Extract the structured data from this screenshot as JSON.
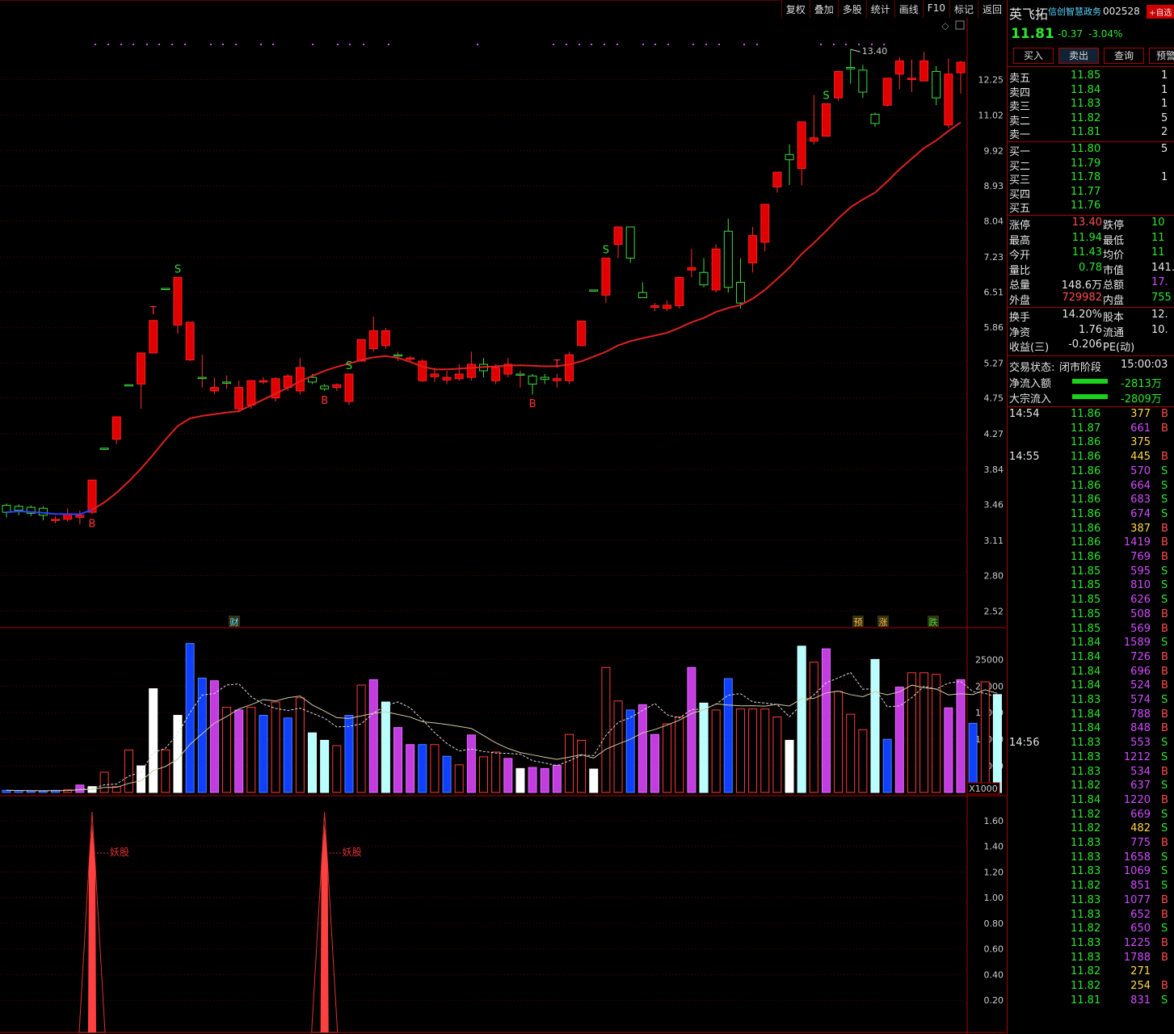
{
  "toolbar": {
    "items": [
      "复权",
      "叠加",
      "多股",
      "统计",
      "画线",
      "F10",
      "标记",
      "返回"
    ]
  },
  "stock": {
    "name": "英飞拓",
    "sector": "信创智慧政务",
    "code": "002528",
    "fav": "+自选",
    "price": "11.81",
    "change": "-0.37",
    "pct": "-3.04%"
  },
  "actions": {
    "buy": "买入",
    "sell": "卖出",
    "query": "查询",
    "warn": "预警"
  },
  "orderbook": {
    "asks": [
      {
        "label": "卖五",
        "price": "11.85",
        "vol": "1"
      },
      {
        "label": "卖四",
        "price": "11.84",
        "vol": "1"
      },
      {
        "label": "卖三",
        "price": "11.83",
        "vol": "1"
      },
      {
        "label": "卖二",
        "price": "11.82",
        "vol": "5"
      },
      {
        "label": "卖一",
        "price": "11.81",
        "vol": "2"
      }
    ],
    "bids": [
      {
        "label": "买一",
        "price": "11.80",
        "vol": "5"
      },
      {
        "label": "买二",
        "price": "11.79",
        "vol": ""
      },
      {
        "label": "买三",
        "price": "11.78",
        "vol": "1"
      },
      {
        "label": "买四",
        "price": "11.77",
        "vol": ""
      },
      {
        "label": "买五",
        "price": "11.76",
        "vol": ""
      }
    ]
  },
  "stats": [
    {
      "l1": "涨停",
      "v1": "13.40",
      "c1": "red",
      "l2": "跌停",
      "v2": "10",
      "c2": "green"
    },
    {
      "l1": "最高",
      "v1": "11.94",
      "c1": "green",
      "l2": "最低",
      "v2": "11",
      "c2": "green"
    },
    {
      "l1": "今开",
      "v1": "11.43",
      "c1": "green",
      "l2": "均价",
      "v2": "11",
      "c2": "green"
    },
    {
      "l1": "量比",
      "v1": "0.78",
      "c1": "green",
      "l2": "市值",
      "v2": "141.",
      "c2": "white"
    },
    {
      "l1": "总量",
      "v1": "148.6万",
      "c1": "white",
      "l2": "总额",
      "v2": "17.",
      "c2": "mag"
    },
    {
      "l1": "外盘",
      "v1": "729982",
      "c1": "red",
      "l2": "内盘",
      "v2": "755",
      "c2": "green"
    }
  ],
  "stats2": [
    {
      "l1": "换手",
      "v1": "14.20%",
      "l2": "股本",
      "v2": "12."
    },
    {
      "l1": "净资",
      "v1": "1.76",
      "l2": "流通",
      "v2": "10."
    },
    {
      "l1": "收益(三)",
      "v1": "-0.206",
      "l2": "PE(动)",
      "v2": ""
    }
  ],
  "trade_status": {
    "label": "交易状态:",
    "value": "闭市阶段",
    "time": "15:00:03"
  },
  "flows": [
    {
      "label": "净流入额",
      "value": "-2813万"
    },
    {
      "label": "大宗流入",
      "value": "-2809万"
    }
  ],
  "ticks": [
    {
      "t": "14:54",
      "p": "11.86",
      "v": "377",
      "s": "B"
    },
    {
      "t": "",
      "p": "11.87",
      "v": "661",
      "s": "B"
    },
    {
      "t": "",
      "p": "11.86",
      "v": "375",
      "s": ""
    },
    {
      "t": "14:55",
      "p": "11.86",
      "v": "445",
      "s": "B"
    },
    {
      "t": "",
      "p": "11.86",
      "v": "570",
      "s": "S"
    },
    {
      "t": "",
      "p": "11.86",
      "v": "664",
      "s": "S"
    },
    {
      "t": "",
      "p": "11.86",
      "v": "683",
      "s": "S"
    },
    {
      "t": "",
      "p": "11.86",
      "v": "674",
      "s": "S"
    },
    {
      "t": "",
      "p": "11.86",
      "v": "387",
      "s": "B"
    },
    {
      "t": "",
      "p": "11.86",
      "v": "1419",
      "s": "B"
    },
    {
      "t": "",
      "p": "11.86",
      "v": "769",
      "s": "B"
    },
    {
      "t": "",
      "p": "11.85",
      "v": "595",
      "s": "S"
    },
    {
      "t": "",
      "p": "11.85",
      "v": "810",
      "s": "S"
    },
    {
      "t": "",
      "p": "11.85",
      "v": "626",
      "s": "S"
    },
    {
      "t": "",
      "p": "11.85",
      "v": "508",
      "s": "B"
    },
    {
      "t": "",
      "p": "11.85",
      "v": "569",
      "s": "B"
    },
    {
      "t": "",
      "p": "11.84",
      "v": "1589",
      "s": "S"
    },
    {
      "t": "",
      "p": "11.84",
      "v": "726",
      "s": "B"
    },
    {
      "t": "",
      "p": "11.84",
      "v": "696",
      "s": "B"
    },
    {
      "t": "",
      "p": "11.84",
      "v": "524",
      "s": "B"
    },
    {
      "t": "",
      "p": "11.83",
      "v": "574",
      "s": "S"
    },
    {
      "t": "",
      "p": "11.84",
      "v": "788",
      "s": "B"
    },
    {
      "t": "",
      "p": "11.84",
      "v": "848",
      "s": "B"
    },
    {
      "t": "14:56",
      "p": "11.83",
      "v": "553",
      "s": "S"
    },
    {
      "t": "",
      "p": "11.83",
      "v": "1212",
      "s": "S"
    },
    {
      "t": "",
      "p": "11.83",
      "v": "534",
      "s": "B"
    },
    {
      "t": "",
      "p": "11.82",
      "v": "637",
      "s": "S"
    },
    {
      "t": "",
      "p": "11.84",
      "v": "1220",
      "s": "B"
    },
    {
      "t": "",
      "p": "11.82",
      "v": "669",
      "s": "S"
    },
    {
      "t": "",
      "p": "11.82",
      "v": "482",
      "s": "S"
    },
    {
      "t": "",
      "p": "11.83",
      "v": "775",
      "s": "B"
    },
    {
      "t": "",
      "p": "11.83",
      "v": "1658",
      "s": "S"
    },
    {
      "t": "",
      "p": "11.83",
      "v": "1069",
      "s": "S"
    },
    {
      "t": "",
      "p": "11.82",
      "v": "851",
      "s": "S"
    },
    {
      "t": "",
      "p": "11.83",
      "v": "1077",
      "s": "B"
    },
    {
      "t": "",
      "p": "11.83",
      "v": "652",
      "s": "B"
    },
    {
      "t": "",
      "p": "11.82",
      "v": "650",
      "s": "S"
    },
    {
      "t": "",
      "p": "11.83",
      "v": "1225",
      "s": "B"
    },
    {
      "t": "",
      "p": "11.83",
      "v": "1788",
      "s": "B"
    },
    {
      "t": "",
      "p": "11.82",
      "v": "271",
      "s": ""
    },
    {
      "t": "",
      "p": "11.82",
      "v": "254",
      "s": "B"
    },
    {
      "t": "",
      "p": "11.81",
      "v": "831",
      "s": "S"
    }
  ],
  "chart_data": {
    "type": "candlestick",
    "price_axis_ticks": [
      "12.25",
      "11.02",
      "9.92",
      "8.93",
      "8.04",
      "7.23",
      "6.51",
      "5.86",
      "5.27",
      "4.75",
      "4.27",
      "3.84",
      "3.46",
      "3.11",
      "2.80",
      "2.52"
    ],
    "price_axis_scale": "log",
    "max_marker": "13.40",
    "volume_axis_ticks": [
      "25000",
      "20000",
      "15000",
      "10000",
      "5000"
    ],
    "volume_unit": "X1000",
    "indicator_axis_ticks": [
      "1.60",
      "1.40",
      "1.20",
      "1.00",
      "0.80",
      "0.60",
      "0.40",
      "0.20"
    ],
    "event_markers": [
      "财",
      "预",
      "涨",
      "跌"
    ],
    "indicator_label": "妖股",
    "candles": [
      {
        "o": 3.45,
        "h": 3.47,
        "l": 3.33,
        "c": 3.38
      },
      {
        "o": 3.44,
        "h": 3.46,
        "l": 3.35,
        "c": 3.4
      },
      {
        "o": 3.43,
        "h": 3.45,
        "l": 3.34,
        "c": 3.37
      },
      {
        "o": 3.42,
        "h": 3.44,
        "l": 3.3,
        "c": 3.35
      },
      {
        "o": 3.3,
        "h": 3.34,
        "l": 3.27,
        "c": 3.31
      },
      {
        "o": 3.31,
        "h": 3.42,
        "l": 3.29,
        "c": 3.36
      },
      {
        "o": 3.33,
        "h": 3.4,
        "l": 3.26,
        "c": 3.35
      },
      {
        "o": 3.38,
        "h": 3.72,
        "l": 3.36,
        "c": 3.72
      },
      {
        "o": 4.09,
        "h": 4.09,
        "l": 4.09,
        "c": 4.09
      },
      {
        "o": 4.2,
        "h": 4.49,
        "l": 4.14,
        "c": 4.49
      },
      {
        "o": 4.94,
        "h": 4.94,
        "l": 4.94,
        "c": 4.94
      },
      {
        "o": 4.95,
        "h": 5.43,
        "l": 4.6,
        "c": 5.43
      },
      {
        "o": 5.43,
        "h": 5.98,
        "l": 5.43,
        "c": 5.98
      },
      {
        "o": 6.58,
        "h": 6.58,
        "l": 6.58,
        "c": 6.58
      },
      {
        "o": 5.9,
        "h": 6.8,
        "l": 5.75,
        "c": 6.8
      },
      {
        "o": 5.32,
        "h": 5.95,
        "l": 5.3,
        "c": 5.95
      },
      {
        "o": 5.05,
        "h": 5.4,
        "l": 4.9,
        "c": 5.05
      },
      {
        "o": 4.85,
        "h": 5.05,
        "l": 4.8,
        "c": 4.9
      },
      {
        "o": 4.98,
        "h": 5.08,
        "l": 4.88,
        "c": 4.98
      },
      {
        "o": 4.6,
        "h": 5.0,
        "l": 4.55,
        "c": 4.9
      },
      {
        "o": 4.65,
        "h": 5.0,
        "l": 4.6,
        "c": 5.0
      },
      {
        "o": 4.98,
        "h": 5.05,
        "l": 4.95,
        "c": 5.0
      },
      {
        "o": 4.75,
        "h": 5.05,
        "l": 4.7,
        "c": 5.03
      },
      {
        "o": 4.9,
        "h": 5.1,
        "l": 4.85,
        "c": 5.07
      },
      {
        "o": 4.85,
        "h": 5.35,
        "l": 4.8,
        "c": 5.2
      },
      {
        "o": 5.05,
        "h": 5.1,
        "l": 4.95,
        "c": 4.98
      },
      {
        "o": 4.92,
        "h": 4.95,
        "l": 4.85,
        "c": 4.88
      },
      {
        "o": 4.9,
        "h": 4.96,
        "l": 4.85,
        "c": 4.94
      },
      {
        "o": 4.7,
        "h": 5.1,
        "l": 4.65,
        "c": 5.1
      },
      {
        "o": 5.3,
        "h": 5.65,
        "l": 5.3,
        "c": 5.65
      },
      {
        "o": 5.5,
        "h": 6.05,
        "l": 5.45,
        "c": 5.8
      },
      {
        "o": 5.55,
        "h": 5.85,
        "l": 5.5,
        "c": 5.8
      },
      {
        "o": 5.4,
        "h": 5.45,
        "l": 5.3,
        "c": 5.4
      },
      {
        "o": 5.33,
        "h": 5.38,
        "l": 5.28,
        "c": 5.35
      },
      {
        "o": 5.0,
        "h": 5.33,
        "l": 4.98,
        "c": 5.3
      },
      {
        "o": 5.06,
        "h": 5.2,
        "l": 4.98,
        "c": 5.1
      },
      {
        "o": 5.01,
        "h": 5.15,
        "l": 4.95,
        "c": 5.05
      },
      {
        "o": 5.03,
        "h": 5.25,
        "l": 5.0,
        "c": 5.1
      },
      {
        "o": 5.05,
        "h": 5.45,
        "l": 5.0,
        "c": 5.25
      },
      {
        "o": 5.25,
        "h": 5.35,
        "l": 5.05,
        "c": 5.15
      },
      {
        "o": 5.0,
        "h": 5.25,
        "l": 4.95,
        "c": 5.2
      },
      {
        "o": 5.1,
        "h": 5.35,
        "l": 5.05,
        "c": 5.25
      },
      {
        "o": 5.1,
        "h": 5.15,
        "l": 4.9,
        "c": 5.1
      },
      {
        "o": 5.07,
        "h": 5.1,
        "l": 4.8,
        "c": 4.95
      },
      {
        "o": 5.05,
        "h": 5.1,
        "l": 4.95,
        "c": 5.02
      },
      {
        "o": 5.0,
        "h": 5.1,
        "l": 4.9,
        "c": 5.03
      },
      {
        "o": 5.0,
        "h": 5.45,
        "l": 4.95,
        "c": 5.4
      },
      {
        "o": 5.55,
        "h": 5.97,
        "l": 5.55,
        "c": 5.97
      },
      {
        "o": 6.55,
        "h": 6.55,
        "l": 6.55,
        "c": 6.55
      },
      {
        "o": 6.45,
        "h": 7.2,
        "l": 6.3,
        "c": 7.2
      },
      {
        "o": 7.5,
        "h": 7.9,
        "l": 7.2,
        "c": 7.9
      },
      {
        "o": 7.9,
        "h": 7.9,
        "l": 7.1,
        "c": 7.2
      },
      {
        "o": 6.5,
        "h": 6.7,
        "l": 6.4,
        "c": 6.4
      },
      {
        "o": 6.22,
        "h": 6.3,
        "l": 6.15,
        "c": 6.25
      },
      {
        "o": 6.2,
        "h": 6.35,
        "l": 6.15,
        "c": 6.26
      },
      {
        "o": 6.25,
        "h": 6.8,
        "l": 6.2,
        "c": 6.8
      },
      {
        "o": 6.95,
        "h": 7.4,
        "l": 6.8,
        "c": 7.0
      },
      {
        "o": 6.9,
        "h": 7.2,
        "l": 6.6,
        "c": 6.65
      },
      {
        "o": 6.55,
        "h": 7.5,
        "l": 6.5,
        "c": 7.4
      },
      {
        "o": 7.8,
        "h": 8.1,
        "l": 6.5,
        "c": 6.6
      },
      {
        "o": 6.7,
        "h": 7.2,
        "l": 6.2,
        "c": 6.3
      },
      {
        "o": 7.1,
        "h": 7.9,
        "l": 6.9,
        "c": 7.7
      },
      {
        "o": 7.55,
        "h": 8.45,
        "l": 7.35,
        "c": 8.45
      },
      {
        "o": 8.9,
        "h": 9.3,
        "l": 8.75,
        "c": 9.3
      },
      {
        "o": 9.8,
        "h": 10.1,
        "l": 8.95,
        "c": 9.65
      },
      {
        "o": 9.4,
        "h": 10.8,
        "l": 8.95,
        "c": 10.8
      },
      {
        "o": 10.2,
        "h": 11.7,
        "l": 10.1,
        "c": 10.3
      },
      {
        "o": 10.35,
        "h": 11.4,
        "l": 10.35,
        "c": 11.4
      },
      {
        "o": 11.6,
        "h": 12.55,
        "l": 11.5,
        "c": 12.55
      },
      {
        "o": 12.7,
        "h": 13.4,
        "l": 12.1,
        "c": 12.65
      },
      {
        "o": 12.6,
        "h": 12.8,
        "l": 11.6,
        "c": 11.8
      },
      {
        "o": 11.05,
        "h": 11.1,
        "l": 10.65,
        "c": 10.75
      },
      {
        "o": 11.35,
        "h": 12.3,
        "l": 11.3,
        "c": 12.3
      },
      {
        "o": 12.45,
        "h": 13.1,
        "l": 11.9,
        "c": 12.95
      },
      {
        "o": 12.25,
        "h": 13.0,
        "l": 11.8,
        "c": 12.3
      },
      {
        "o": 12.2,
        "h": 13.3,
        "l": 12.2,
        "c": 12.95
      },
      {
        "o": 12.55,
        "h": 12.75,
        "l": 11.35,
        "c": 11.6
      },
      {
        "o": 10.7,
        "h": 13.05,
        "l": 10.6,
        "c": 12.45
      },
      {
        "o": 12.5,
        "h": 12.95,
        "l": 11.75,
        "c": 12.9
      }
    ],
    "volumes": [
      {
        "v": 400,
        "k": "blue"
      },
      {
        "v": 350,
        "k": "blue"
      },
      {
        "v": 300,
        "k": "blue"
      },
      {
        "v": 250,
        "k": "blue"
      },
      {
        "v": 400,
        "k": "blue"
      },
      {
        "v": 500,
        "k": "red"
      },
      {
        "v": 1400,
        "k": "mag"
      },
      {
        "v": 1100,
        "k": "white"
      },
      {
        "v": 3800,
        "k": "red"
      },
      {
        "v": 1100,
        "k": "red"
      },
      {
        "v": 8000,
        "k": "red"
      },
      {
        "v": 5000,
        "k": "white"
      },
      {
        "v": 19500,
        "k": "white"
      },
      {
        "v": 8000,
        "k": "red"
      },
      {
        "v": 14500,
        "k": "white"
      },
      {
        "v": 28000,
        "k": "blue"
      },
      {
        "v": 21500,
        "k": "blue"
      },
      {
        "v": 21000,
        "k": "mag"
      },
      {
        "v": 16000,
        "k": "red"
      },
      {
        "v": 15500,
        "k": "mag"
      },
      {
        "v": 16000,
        "k": "red"
      },
      {
        "v": 14500,
        "k": "blue"
      },
      {
        "v": 17000,
        "k": "red"
      },
      {
        "v": 14000,
        "k": "blue"
      },
      {
        "v": 17800,
        "k": "red"
      },
      {
        "v": 11200,
        "k": "cyan"
      },
      {
        "v": 9800,
        "k": "cyan"
      },
      {
        "v": 8800,
        "k": "red"
      },
      {
        "v": 14500,
        "k": "blue"
      },
      {
        "v": 20200,
        "k": "red"
      },
      {
        "v": 21200,
        "k": "mag"
      },
      {
        "v": 17000,
        "k": "cyan"
      },
      {
        "v": 12200,
        "k": "mag"
      },
      {
        "v": 9000,
        "k": "mag"
      },
      {
        "v": 9000,
        "k": "blue"
      },
      {
        "v": 9000,
        "k": "red"
      },
      {
        "v": 6800,
        "k": "blue"
      },
      {
        "v": 5200,
        "k": "red"
      },
      {
        "v": 10800,
        "k": "mag"
      },
      {
        "v": 6700,
        "k": "red"
      },
      {
        "v": 7600,
        "k": "red"
      },
      {
        "v": 6400,
        "k": "mag"
      },
      {
        "v": 4500,
        "k": "white"
      },
      {
        "v": 4700,
        "k": "mag"
      },
      {
        "v": 4500,
        "k": "mag"
      },
      {
        "v": 5100,
        "k": "mag"
      },
      {
        "v": 10900,
        "k": "red"
      },
      {
        "v": 9800,
        "k": "red"
      },
      {
        "v": 4400,
        "k": "white"
      },
      {
        "v": 23500,
        "k": "red"
      },
      {
        "v": 17200,
        "k": "red"
      },
      {
        "v": 15500,
        "k": "blue"
      },
      {
        "v": 16500,
        "k": "mag"
      },
      {
        "v": 10900,
        "k": "mag"
      },
      {
        "v": 12900,
        "k": "red"
      },
      {
        "v": 14200,
        "k": "red"
      },
      {
        "v": 23500,
        "k": "mag"
      },
      {
        "v": 16800,
        "k": "cyan"
      },
      {
        "v": 15500,
        "k": "red"
      },
      {
        "v": 21400,
        "k": "blue"
      },
      {
        "v": 15700,
        "k": "red"
      },
      {
        "v": 15700,
        "k": "red"
      },
      {
        "v": 15700,
        "k": "red"
      },
      {
        "v": 14200,
        "k": "red"
      },
      {
        "v": 9800,
        "k": "white"
      },
      {
        "v": 27500,
        "k": "cyan"
      },
      {
        "v": 24500,
        "k": "red"
      },
      {
        "v": 27000,
        "k": "mag"
      },
      {
        "v": 19000,
        "k": "red"
      },
      {
        "v": 14700,
        "k": "red"
      },
      {
        "v": 11800,
        "k": "red"
      },
      {
        "v": 25000,
        "k": "cyan"
      },
      {
        "v": 10000,
        "k": "blue"
      },
      {
        "v": 19800,
        "k": "mag"
      },
      {
        "v": 22500,
        "k": "red"
      },
      {
        "v": 22500,
        "k": "red"
      },
      {
        "v": 22200,
        "k": "red"
      },
      {
        "v": 15900,
        "k": "mag"
      },
      {
        "v": 21200,
        "k": "mag"
      },
      {
        "v": 13000,
        "k": "blue"
      },
      {
        "v": 20800,
        "k": "red"
      },
      {
        "v": 18400,
        "k": "cyan"
      }
    ],
    "signals": [
      {
        "i": 7,
        "t": "B"
      },
      {
        "i": 12,
        "t": "T"
      },
      {
        "i": 14,
        "t": "S"
      },
      {
        "i": 26,
        "t": "B"
      },
      {
        "i": 28,
        "t": "S"
      },
      {
        "i": 43,
        "t": "B"
      },
      {
        "i": 45,
        "t": "T"
      },
      {
        "i": 49,
        "t": "S"
      },
      {
        "i": 67,
        "t": "S"
      }
    ],
    "indicator_peaks": [
      7,
      26
    ]
  }
}
